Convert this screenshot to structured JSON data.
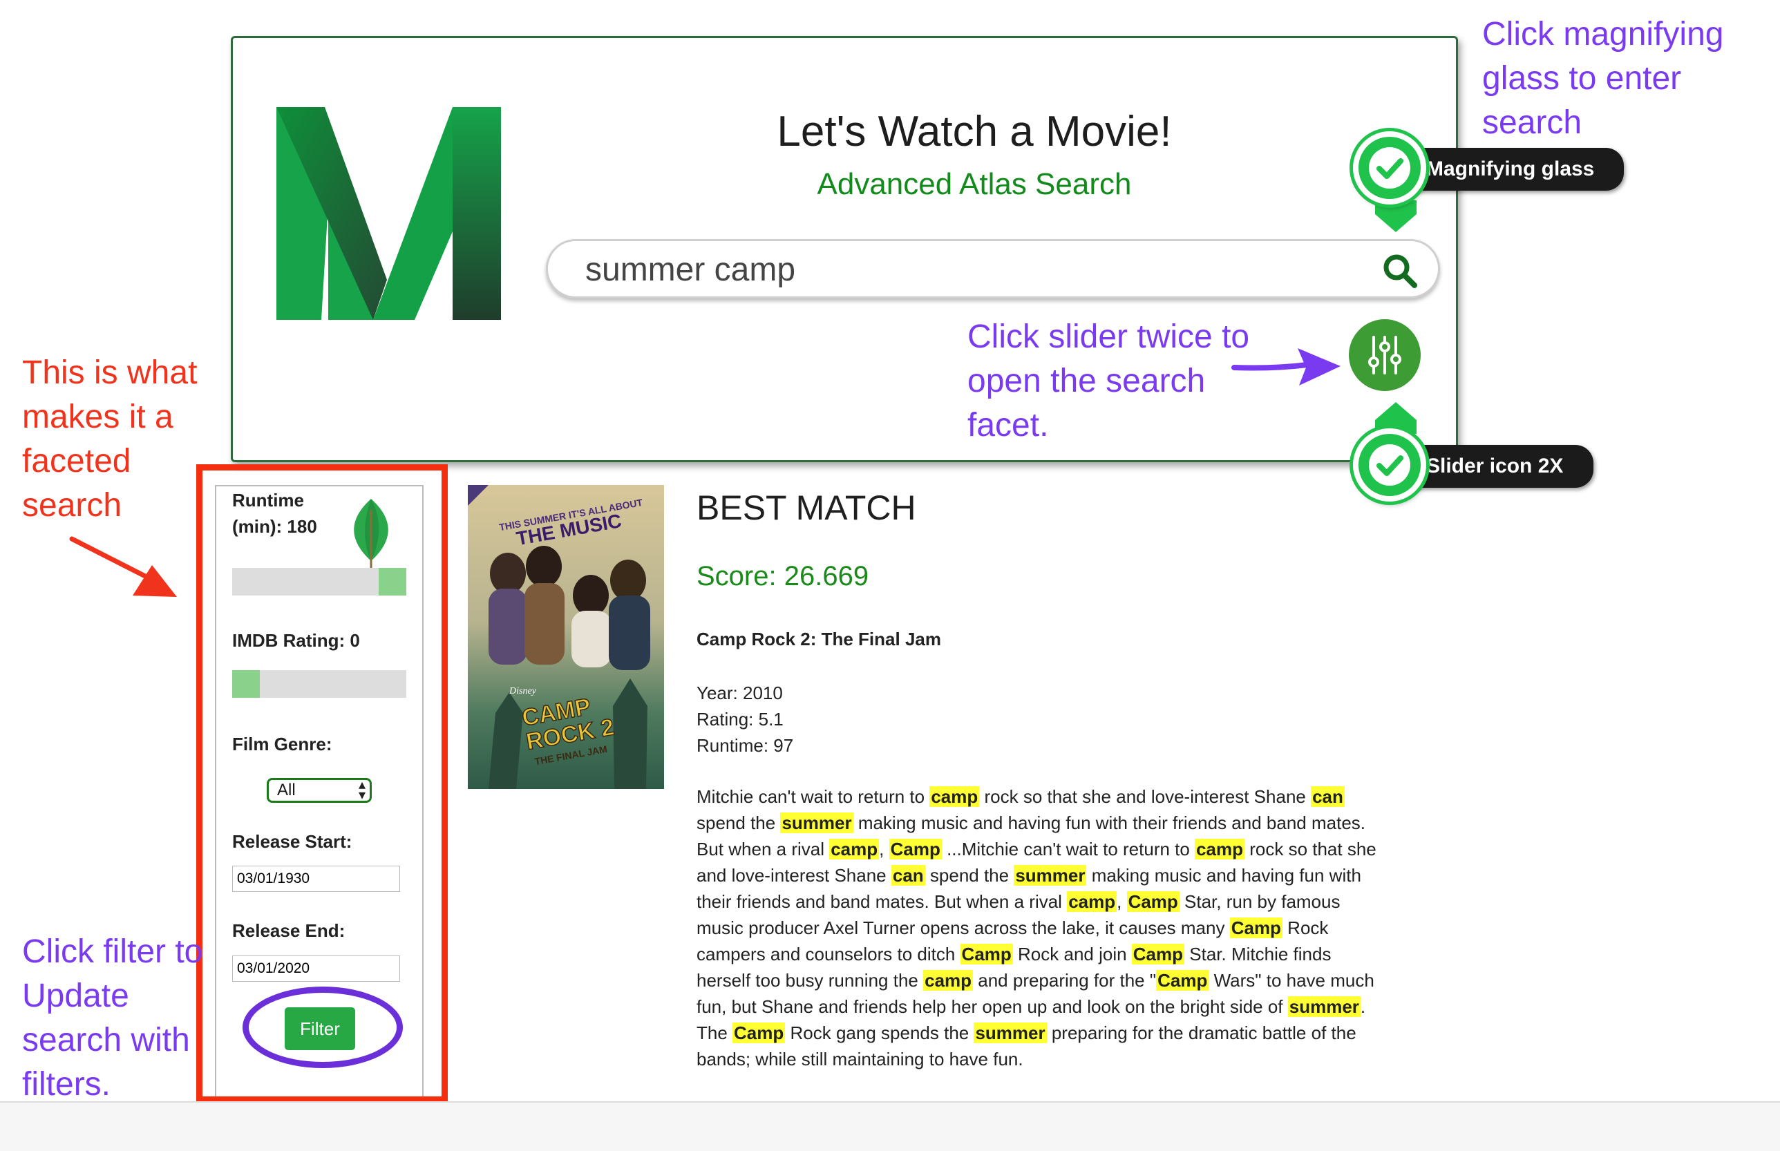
{
  "header": {
    "title": "Let's Watch a Movie!",
    "subtitle": "Advanced Atlas Search"
  },
  "search": {
    "query": "summer camp",
    "search_icon": "search-icon",
    "slider_icon": "sliders-icon"
  },
  "facets": {
    "runtime_label": "Runtime (min): 180",
    "runtime_value_fraction": 1.0,
    "imdb_label": "IMDB Rating: 0",
    "imdb_value_fraction": 0.0,
    "genre_label": "Film Genre:",
    "genre_selected": "All",
    "release_start_label": "Release Start:",
    "release_start_value": "03/01/1930",
    "release_end_label": "Release End:",
    "release_end_value": "03/01/2020",
    "filter_button": "Filter"
  },
  "result": {
    "heading": "BEST MATCH",
    "score": "Score: 26.669",
    "title": "Camp Rock 2: The Final Jam",
    "year": "Year: 2010",
    "rating": "Rating: 5.1",
    "runtime": "Runtime: 97",
    "poster_text": {
      "tagline": "THIS SUMMER IT'S ALL ABOUT THE MUSIC",
      "brand": "Disney",
      "logo": "CAMP ROCK 2 THE FINAL JAM"
    }
  },
  "annotations": {
    "faceted": "This is what makes it a faceted search",
    "magnify": "Click magnifying glass to enter search",
    "slider": "Click slider twice to open the search facet.",
    "filter": "Click filter to Update search with filters.",
    "tip_magnify": "Magnifying glass",
    "tip_slider": "Slider icon 2X"
  },
  "colors": {
    "accent_green": "#138a1c",
    "highlight": "#ffff33",
    "annotation_red": "#f0331c",
    "annotation_purple": "#7a3bf0"
  }
}
